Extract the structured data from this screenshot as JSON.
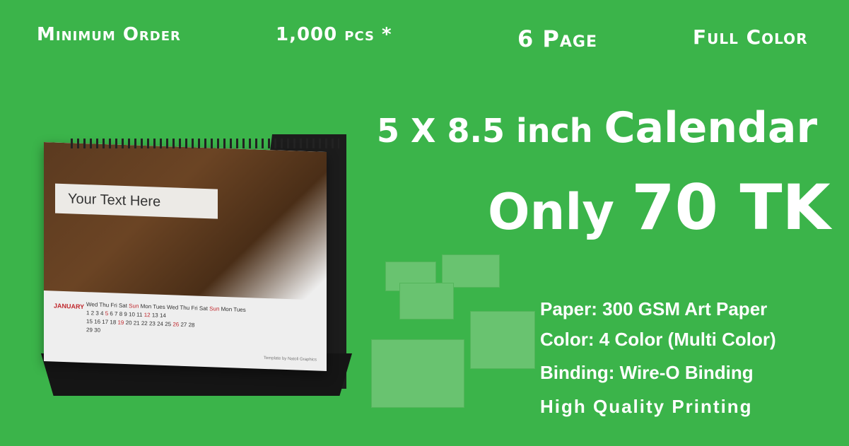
{
  "header": {
    "min_order": "Minimum Order",
    "quantity": "1,000 pcs *",
    "pages": "6 Page",
    "color": "Full Color"
  },
  "product": {
    "size_prefix": "5 X 8.5 inch",
    "size_word": "Calendar",
    "price_prefix": "Only",
    "price": "70 TK"
  },
  "specs": [
    "Paper: 300 GSM Art Paper",
    "Color: 4 Color (Multi Color)",
    "Binding: Wire-O Binding",
    "High Quality Printing"
  ],
  "mockup": {
    "text_box": "Your Text Here",
    "month": "JANUARY",
    "credit": "Template by Natoli Graphics"
  },
  "colors": {
    "background": "#3bb44a",
    "text": "#ffffff"
  }
}
